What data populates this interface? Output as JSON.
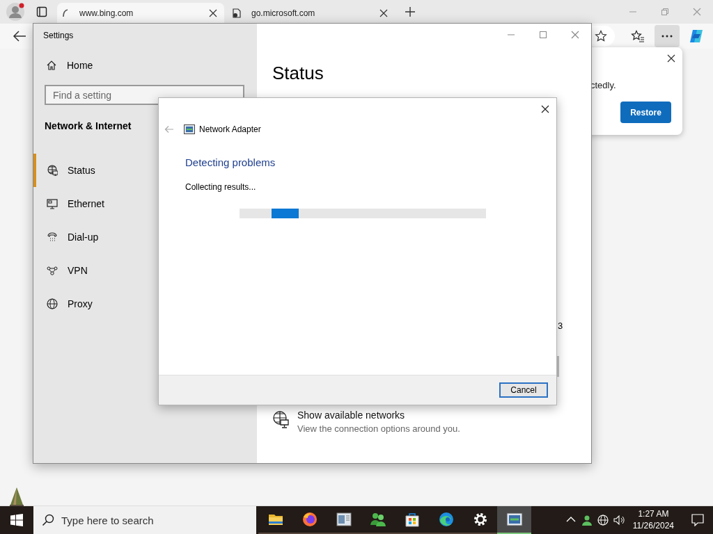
{
  "browser": {
    "tabs": [
      {
        "title": "www.bing.com",
        "selected": true
      },
      {
        "title": "go.microsoft.com",
        "selected": false
      }
    ]
  },
  "restore_popup": {
    "message": "ctedly.",
    "button": "Restore"
  },
  "settings": {
    "title": "Settings",
    "home": "Home",
    "search": {
      "placeholder": "Find a setting"
    },
    "section": "Network & Internet",
    "nav": [
      {
        "label": "Status",
        "kind": "status",
        "selected": true
      },
      {
        "label": "Ethernet",
        "kind": "ethernet",
        "selected": false
      },
      {
        "label": "Dial-up",
        "kind": "dialup",
        "selected": false
      },
      {
        "label": "VPN",
        "kind": "vpn",
        "selected": false
      },
      {
        "label": "Proxy",
        "kind": "proxy",
        "selected": false
      }
    ],
    "heading": "Status",
    "cut_text": "3",
    "network_link": {
      "title": "Show available networks",
      "description": "View the connection options around you."
    }
  },
  "dialog": {
    "title": "Network Adapter",
    "heading": "Detecting problems",
    "status": "Collecting results...",
    "cancel": "Cancel"
  },
  "taskbar": {
    "search": {
      "placeholder": "Type here to search"
    },
    "apps": [
      {
        "kind": "folder",
        "selected": false
      },
      {
        "kind": "firefox",
        "selected": false
      },
      {
        "kind": "window",
        "selected": false
      },
      {
        "kind": "people",
        "selected": false
      },
      {
        "kind": "store",
        "selected": false
      },
      {
        "kind": "edge",
        "selected": false
      },
      {
        "kind": "gear",
        "selected": false
      },
      {
        "kind": "adapter",
        "selected": true
      }
    ],
    "time": "1:27 AM",
    "date": "11/26/2024"
  }
}
